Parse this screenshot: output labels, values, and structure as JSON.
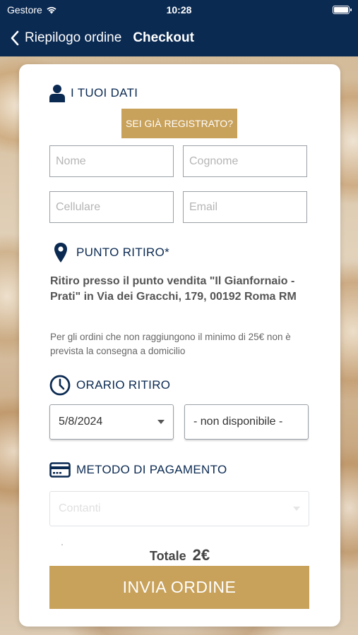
{
  "statusbar": {
    "carrier": "Gestore",
    "time": "10:28"
  },
  "navbar": {
    "back_label": "Riepilogo ordine",
    "title": "Checkout"
  },
  "sections": {
    "user_data": {
      "title": "I TUOI DATI",
      "registered_button": "SEI GIÀ REGISTRATO?",
      "fields": {
        "first_name_placeholder": "Nome",
        "last_name_placeholder": "Cognome",
        "phone_placeholder": "Cellulare",
        "email_placeholder": "Email"
      }
    },
    "pickup_point": {
      "title": "PUNTO RITIRO*",
      "address": "Ritiro presso il punto vendita \"Il Gianfornaio - Prati\" in Via dei Gracchi, 179, 00192 Roma RM",
      "note": "Per gli ordini che non raggiungono il minimo di 25€ non è prevista la consegna a domicilio"
    },
    "pickup_time": {
      "title": "ORARIO RITIRO",
      "date_value": "5/8/2024",
      "time_value": "- non disponibile -"
    },
    "payment": {
      "title": "METODO DI PAGAMENTO",
      "method_value": "Contanti"
    }
  },
  "total": {
    "label": "Totale",
    "amount": "2€"
  },
  "submit_label": "INVIA ORDINE",
  "colors": {
    "navy": "#0b2a52",
    "gold": "#c8a15a"
  }
}
